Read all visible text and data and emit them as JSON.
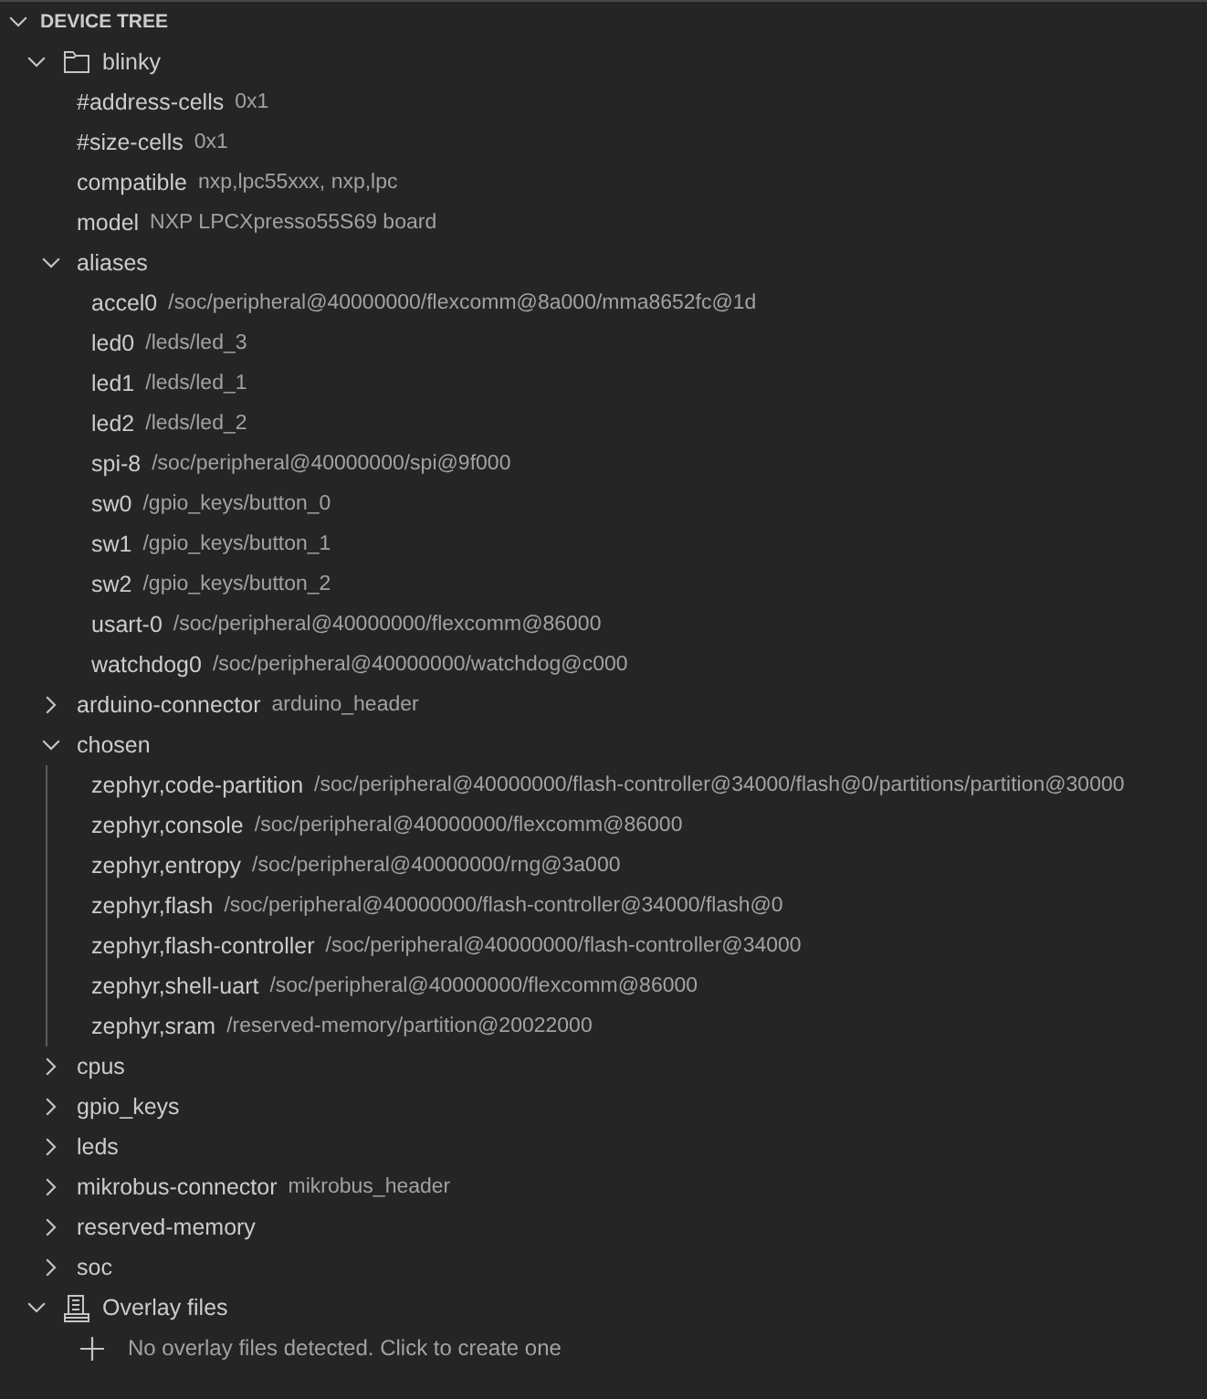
{
  "panel": {
    "title": "DEVICE TREE",
    "expanded": true
  },
  "tree": [
    {
      "kind": "folder",
      "label": "blinky",
      "expanded": true,
      "children": [
        {
          "label": "#address-cells",
          "description": "0x1"
        },
        {
          "label": "#size-cells",
          "description": "0x1"
        },
        {
          "label": "compatible",
          "description": "nxp,lpc55xxx, nxp,lpc"
        },
        {
          "label": "model",
          "description": "NXP LPCXpresso55S69 board"
        },
        {
          "label": "aliases",
          "expanded": true,
          "children": [
            {
              "label": "accel0",
              "description": "/soc/peripheral@40000000/flexcomm@8a000/mma8652fc@1d"
            },
            {
              "label": "led0",
              "description": "/leds/led_3"
            },
            {
              "label": "led1",
              "description": "/leds/led_1"
            },
            {
              "label": "led2",
              "description": "/leds/led_2"
            },
            {
              "label": "spi-8",
              "description": "/soc/peripheral@40000000/spi@9f000"
            },
            {
              "label": "sw0",
              "description": "/gpio_keys/button_0"
            },
            {
              "label": "sw1",
              "description": "/gpio_keys/button_1"
            },
            {
              "label": "sw2",
              "description": "/gpio_keys/button_2"
            },
            {
              "label": "usart-0",
              "description": "/soc/peripheral@40000000/flexcomm@86000"
            },
            {
              "label": "watchdog0",
              "description": "/soc/peripheral@40000000/watchdog@c000"
            }
          ]
        },
        {
          "label": "arduino-connector",
          "description": "arduino_header",
          "expanded": false
        },
        {
          "label": "chosen",
          "expanded": true,
          "indent_guide": true,
          "children": [
            {
              "label": "zephyr,code-partition",
              "description": "/soc/peripheral@40000000/flash-controller@34000/flash@0/partitions/partition@30000"
            },
            {
              "label": "zephyr,console",
              "description": "/soc/peripheral@40000000/flexcomm@86000"
            },
            {
              "label": "zephyr,entropy",
              "description": "/soc/peripheral@40000000/rng@3a000"
            },
            {
              "label": "zephyr,flash",
              "description": "/soc/peripheral@40000000/flash-controller@34000/flash@0"
            },
            {
              "label": "zephyr,flash-controller",
              "description": "/soc/peripheral@40000000/flash-controller@34000"
            },
            {
              "label": "zephyr,shell-uart",
              "description": "/soc/peripheral@40000000/flexcomm@86000"
            },
            {
              "label": "zephyr,sram",
              "description": "/reserved-memory/partition@20022000"
            }
          ]
        },
        {
          "label": "cpus",
          "expanded": false
        },
        {
          "label": "gpio_keys",
          "expanded": false
        },
        {
          "label": "leds",
          "expanded": false
        },
        {
          "label": "mikrobus-connector",
          "description": "mikrobus_header",
          "expanded": false
        },
        {
          "label": "reserved-memory",
          "expanded": false
        },
        {
          "label": "soc",
          "expanded": false
        }
      ]
    },
    {
      "kind": "overlay",
      "label": "Overlay files",
      "expanded": true,
      "children": [
        {
          "kind": "action",
          "description": "No overlay files detected. Click to create one"
        }
      ]
    }
  ]
}
